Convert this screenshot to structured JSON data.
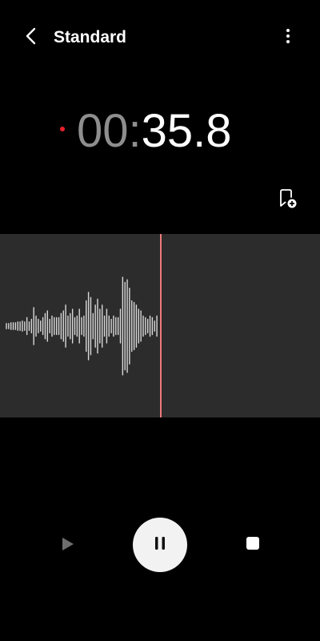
{
  "header": {
    "back_icon": "chevron-left-icon",
    "title": "Standard",
    "more_icon": "more-vertical-icon"
  },
  "recorder": {
    "recording_indicator_color": "#e8212b",
    "elapsed_minutes": "00",
    "separator": ":",
    "elapsed_seconds": "35.8",
    "bookmark_icon": "add-bookmark-icon"
  },
  "waveform": {
    "background_color": "#2c2c2c",
    "playhead_color": "#f07a7a",
    "bar_color": "#d9d9d9",
    "amplitudes": [
      0.03,
      0.03,
      0.04,
      0.04,
      0.04,
      0.05,
      0.05,
      0.06,
      0.05,
      0.1,
      0.05,
      0.08,
      0.22,
      0.12,
      0.08,
      0.06,
      0.1,
      0.15,
      0.18,
      0.08,
      0.12,
      0.1,
      0.1,
      0.1,
      0.15,
      0.18,
      0.25,
      0.12,
      0.15,
      0.2,
      0.1,
      0.12,
      0.2,
      0.1,
      0.12,
      0.3,
      0.4,
      0.34,
      0.15,
      0.25,
      0.32,
      0.2,
      0.25,
      0.12,
      0.2,
      0.12,
      0.08,
      0.12,
      0.1,
      0.1,
      0.2,
      0.58,
      0.52,
      0.55,
      0.45,
      0.3,
      0.28,
      0.25,
      0.2,
      0.18,
      0.12,
      0.1,
      0.08,
      0.12,
      0.1,
      0.06,
      0.12
    ]
  },
  "controls": {
    "play_icon": "play-icon",
    "pause_icon": "pause-icon",
    "stop_icon": "stop-icon"
  }
}
